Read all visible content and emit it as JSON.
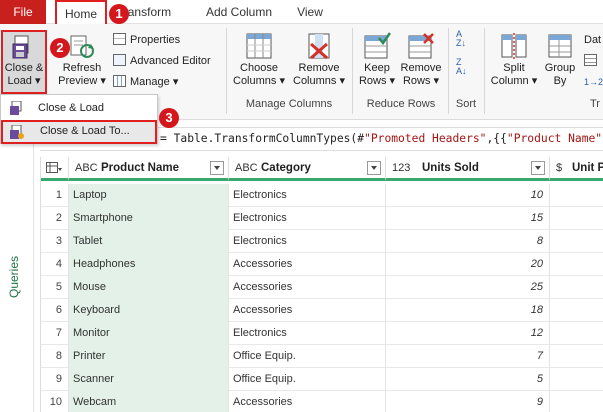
{
  "tabs": {
    "file": "File",
    "home": "Home",
    "transform": "Transform",
    "add_column": "Add Column",
    "view": "View"
  },
  "ribbon": {
    "close_load": {
      "line1": "Close &",
      "line2": "Load"
    },
    "refresh": {
      "line1": "Refresh",
      "line2": "Preview"
    },
    "properties": "Properties",
    "advanced_editor": "Advanced Editor",
    "manage": "Manage",
    "choose_columns": {
      "line1": "Choose",
      "line2": "Columns"
    },
    "remove_columns": {
      "line1": "Remove",
      "line2": "Columns"
    },
    "manage_columns_group": "Manage Columns",
    "keep_rows": {
      "line1": "Keep",
      "line2": "Rows"
    },
    "remove_rows": {
      "line1": "Remove",
      "line2": "Rows"
    },
    "reduce_rows_group": "Reduce Rows",
    "sort_group": "Sort",
    "split_column": {
      "line1": "Split",
      "line2": "Column"
    },
    "group_by": {
      "line1": "Group",
      "line2": "By"
    },
    "data_type_partial": "Dat",
    "transform_group_partial": "Tr"
  },
  "menu": {
    "close_load": "Close & Load",
    "close_load_to": "Close & Load To..."
  },
  "badges": [
    "1",
    "2",
    "3"
  ],
  "formula": {
    "prefix": "= Table.TransformColumnTypes(#",
    "str1": "\"Promoted Headers\"",
    "mid": ",{{",
    "str2": "\"Product Name\"",
    "tail": ","
  },
  "queries_label": "Queries",
  "columns": [
    {
      "type": "ABC",
      "label": "Product Name"
    },
    {
      "type": "ABC",
      "label": "Category"
    },
    {
      "type": "123",
      "label": "Units Sold"
    },
    {
      "type": "$",
      "label": "Unit P"
    }
  ],
  "rows": [
    {
      "n": "1",
      "name": "Laptop",
      "category": "Electronics",
      "units": "10"
    },
    {
      "n": "2",
      "name": "Smartphone",
      "category": "Electronics",
      "units": "15"
    },
    {
      "n": "3",
      "name": "Tablet",
      "category": "Electronics",
      "units": "8"
    },
    {
      "n": "4",
      "name": "Headphones",
      "category": "Accessories",
      "units": "20"
    },
    {
      "n": "5",
      "name": "Mouse",
      "category": "Accessories",
      "units": "25"
    },
    {
      "n": "6",
      "name": "Keyboard",
      "category": "Accessories",
      "units": "18"
    },
    {
      "n": "7",
      "name": "Monitor",
      "category": "Electronics",
      "units": "12"
    },
    {
      "n": "8",
      "name": "Printer",
      "category": "Office Equip.",
      "units": "7"
    },
    {
      "n": "9",
      "name": "Scanner",
      "category": "Office Equip.",
      "units": "5"
    },
    {
      "n": "10",
      "name": "Webcam",
      "category": "Accessories",
      "units": "9"
    }
  ],
  "colors": {
    "file_tab": "#c8211d",
    "highlight_border": "#e02020",
    "badge": "#d4171d",
    "accent_green": "#3aa76d",
    "selected_column": "#e3f1e8"
  }
}
